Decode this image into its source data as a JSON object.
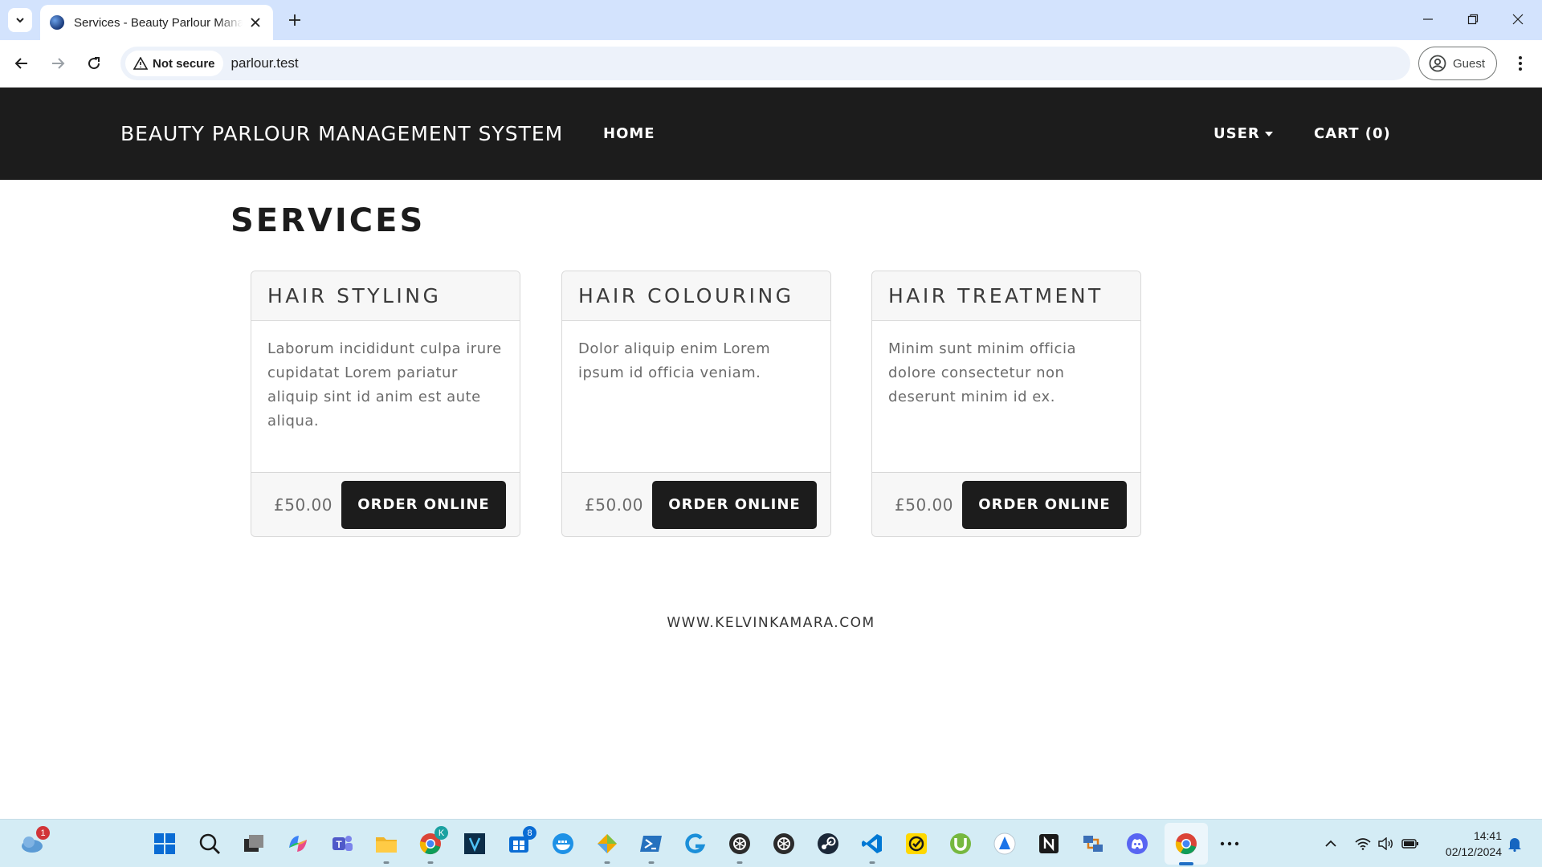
{
  "browser": {
    "tab_title": "Services - Beauty Parlour Management System",
    "security_label": "Not secure",
    "url": "parlour.test",
    "profile_label": "Guest"
  },
  "navbar": {
    "brand": "BEAUTY PARLOUR MANAGEMENT SYSTEM",
    "home": "HOME",
    "user": "USER",
    "cart": "CART (0)"
  },
  "page": {
    "title": "SERVICES"
  },
  "services": [
    {
      "name": "HAIR STYLING",
      "description": "Laborum incididunt culpa irure cupidatat Lorem pariatur aliquip sint id anim est aute aliqua.",
      "price": "£50.00",
      "button": "ORDER ONLINE"
    },
    {
      "name": "HAIR COLOURING",
      "description": "Dolor aliquip enim Lorem ipsum id officia veniam.",
      "price": "£50.00",
      "button": "ORDER ONLINE"
    },
    {
      "name": "HAIR TREATMENT",
      "description": "Minim sunt minim officia dolore consectetur non deserunt minim id ex.",
      "price": "£50.00",
      "button": "ORDER ONLINE"
    }
  ],
  "footer": {
    "text": "WWW.KELVINKAMARA.COM"
  },
  "taskbar": {
    "weather_badge": "1",
    "chrome_badge": "K",
    "store_badge": "8",
    "clock_time": "14:41",
    "clock_date": "02/12/2024",
    "apps": [
      "start-icon",
      "search-icon",
      "task-view-icon",
      "copilot-icon",
      "teams-icon",
      "file-explorer-icon",
      "chrome-profile-icon",
      "visual-studio-icon",
      "microsoft-store-icon",
      "docker-icon",
      "git-icon",
      "powershell-icon",
      "logitech-icon",
      "openai-icon",
      "openai-icon",
      "steam-icon",
      "vscode-icon",
      "norton-icon",
      "utorrent-icon",
      "app-icon",
      "notion-icon",
      "network-icon",
      "discord-icon",
      "chrome-icon"
    ]
  },
  "colors": {
    "navbar_bg": "#1c1c1c",
    "button_bg": "#1c1c1c",
    "card_header_bg": "#f7f7f7",
    "tabstrip_bg": "#d3e3fd",
    "taskbar_bg": "#d4ecf5"
  }
}
